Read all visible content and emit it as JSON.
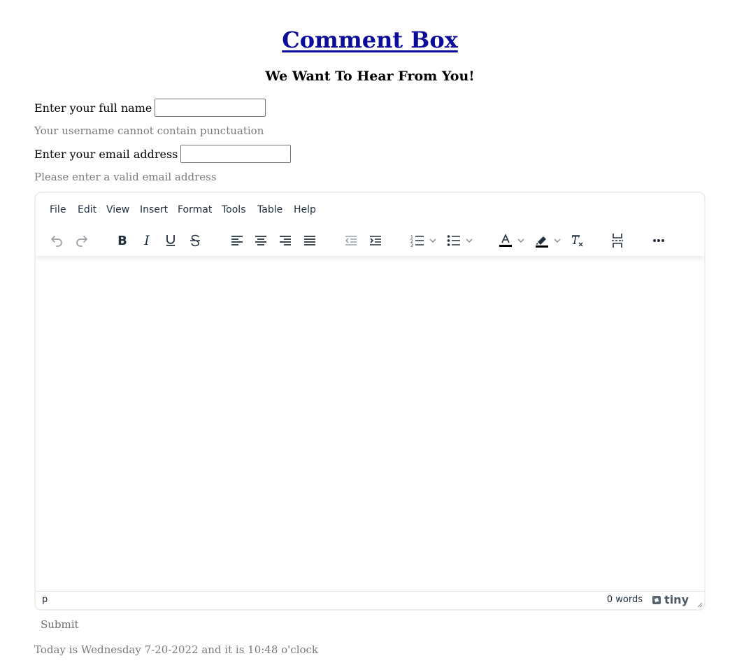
{
  "header": {
    "title": "Comment Box",
    "subtitle": "We Want To Hear From You!"
  },
  "form": {
    "name_label": "Enter your full name",
    "name_value": "",
    "name_hint": "Your username cannot contain punctuation",
    "email_label": "Enter your email address",
    "email_value": "",
    "email_hint": "Please enter a valid email address",
    "submit_label": "Submit"
  },
  "editor": {
    "menu": [
      "File",
      "Edit",
      "View",
      "Insert",
      "Format",
      "Tools",
      "Table",
      "Help"
    ],
    "toolbar_icons": [
      "undo-icon",
      "redo-icon",
      "bold-icon",
      "italic-icon",
      "underline-icon",
      "strikethrough-icon",
      "align-left-icon",
      "align-center-icon",
      "align-right-icon",
      "align-justify-icon",
      "outdent-icon",
      "indent-icon",
      "numbered-list-icon",
      "bullet-list-icon",
      "text-color-icon",
      "highlight-color-icon",
      "clear-formatting-icon",
      "page-break-icon",
      "more-icon"
    ],
    "status_path": "p",
    "word_count": "0 words",
    "brand": "tiny"
  },
  "footer": {
    "text": "Today is Wednesday 7-20-2022 and it is 10:48 o'clock"
  }
}
